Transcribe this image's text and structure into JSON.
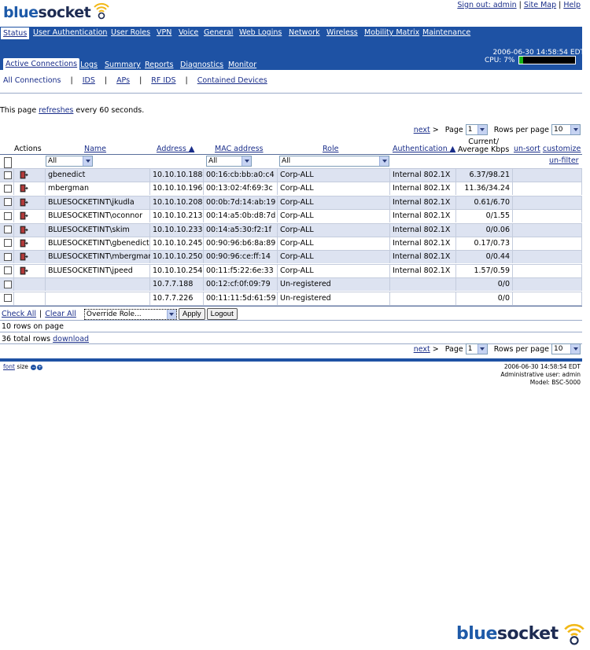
{
  "brand": {
    "blue": "blue",
    "dark": "socket"
  },
  "top_links": [
    "Sign out: admin",
    "Site Map",
    "Help"
  ],
  "nav": [
    "Status",
    "User Authentication",
    "User Roles",
    "VPN",
    "Voice",
    "General",
    "Web Logins",
    "Network",
    "Wireless",
    "Mobility Matrix",
    "Maintenance"
  ],
  "timestamp": "2006-06-30 14:58:54 EDT",
  "cpu": {
    "label": "CPU: 7%",
    "fraction": 0.07
  },
  "subtabs": [
    "Active Connections",
    "Logs",
    "Summary",
    "Reports",
    "Diagnostics",
    "Monitor"
  ],
  "filter_links": [
    "All Connections",
    "IDS",
    "APs",
    "RF IDS",
    "Contained Devices"
  ],
  "refresh": {
    "pre": "This page ",
    "link": "refreshes",
    "post": " every 60 seconds."
  },
  "pager": {
    "next": "next",
    "arrow": ">",
    "page_label": "Page",
    "page_value": "1",
    "rows_label": "Rows per page",
    "rows_value": "10"
  },
  "headers": {
    "actions": "Actions",
    "name": "Name",
    "address": "Address ▲",
    "mac": "MAC address",
    "role": "Role",
    "auth": "Authentication ▲",
    "kbps_1": "Current/",
    "kbps_2": "Average Kbps",
    "unsort": "un-sort",
    "customize": "customize",
    "unfilter": "un-filter"
  },
  "filters": {
    "name": "All",
    "mac": "All",
    "role": "All"
  },
  "rows": [
    {
      "name": "gbenedict",
      "address": "10.10.10.188",
      "mac": "00:16:cb:bb:a0:c4",
      "role": "Corp-ALL",
      "auth": "Internal 802.1X",
      "kbps": "6.37/98.21"
    },
    {
      "name": "mbergman",
      "address": "10.10.10.196",
      "mac": "00:13:02:4f:69:3c",
      "role": "Corp-ALL",
      "auth": "Internal 802.1X",
      "kbps": "11.36/34.24"
    },
    {
      "name": "BLUESOCKETINT\\jkudla",
      "address": "10.10.10.208",
      "mac": "00:0b:7d:14:ab:19",
      "role": "Corp-ALL",
      "auth": "Internal 802.1X",
      "kbps": "0.61/6.70"
    },
    {
      "name": "BLUESOCKETINT\\oconnor",
      "address": "10.10.10.213",
      "mac": "00:14:a5:0b:d8:7d",
      "role": "Corp-ALL",
      "auth": "Internal 802.1X",
      "kbps": "0/1.55"
    },
    {
      "name": "BLUESOCKETINT\\skim",
      "address": "10.10.10.233",
      "mac": "00:14:a5:30:f2:1f",
      "role": "Corp-ALL",
      "auth": "Internal 802.1X",
      "kbps": "0/0.06"
    },
    {
      "name": "BLUESOCKETINT\\gbenedict",
      "address": "10.10.10.245",
      "mac": "00:90:96:b6:8a:89",
      "role": "Corp-ALL",
      "auth": "Internal 802.1X",
      "kbps": "0.17/0.73"
    },
    {
      "name": "BLUESOCKETINT\\mbergman",
      "address": "10.10.10.250",
      "mac": "00:90:96:ce:ff:14",
      "role": "Corp-ALL",
      "auth": "Internal 802.1X",
      "kbps": "0/0.44"
    },
    {
      "name": "BLUESOCKETINT\\jpeed",
      "address": "10.10.10.254",
      "mac": "00:11:f5:22:6e:33",
      "role": "Corp-ALL",
      "auth": "Internal 802.1X",
      "kbps": "1.57/0.59"
    },
    {
      "name": "",
      "address": "10.7.7.188",
      "mac": "00:12:cf:0f:09:79",
      "role": "Un-registered",
      "auth": "",
      "kbps": "0/0"
    },
    {
      "name": "",
      "address": "10.7.7.226",
      "mac": "00:11:11:5d:61:59",
      "role": "Un-registered",
      "auth": "",
      "kbps": "0/0"
    }
  ],
  "row_actions": {
    "check_all": "Check All",
    "sep": "|",
    "clear_all": "Clear All",
    "override": "Override Role...",
    "apply": "Apply",
    "logout": "Logout"
  },
  "rows_on_page": "10 rows on page",
  "total": {
    "text": "36 total rows ",
    "link": "download"
  },
  "footer": {
    "font": "font",
    "size": "size",
    "timestamp": "2006-06-30 14:58:54 EDT",
    "user": "Administrative user: admin",
    "model": "Model: BSC-5000"
  }
}
